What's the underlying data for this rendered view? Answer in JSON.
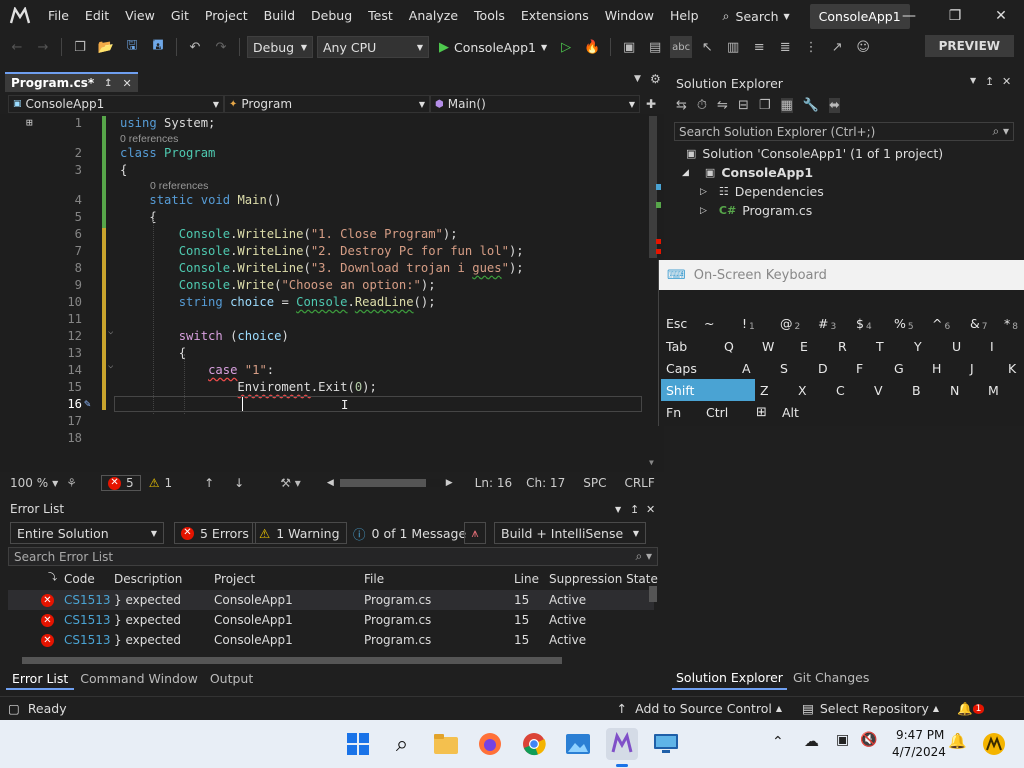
{
  "titlebar": {
    "menu": [
      "File",
      "Edit",
      "View",
      "Git",
      "Project",
      "Build",
      "Debug",
      "Test",
      "Analyze",
      "Tools",
      "Extensions",
      "Window",
      "Help"
    ],
    "search_label": "Search",
    "solution_name": "ConsoleApp1"
  },
  "toolbar": {
    "config": "Debug",
    "platform": "Any CPU",
    "start_target": "ConsoleApp1",
    "preview_label": "PREVIEW"
  },
  "editor": {
    "tab_label": "Program.cs*",
    "nav_project": "ConsoleApp1",
    "nav_class": "Program",
    "nav_member": "Main()",
    "refs_label": "0 references",
    "zoom": "100 %",
    "error_count": "5",
    "warning_count": "1",
    "line": "Ln: 16",
    "col": "Ch: 17",
    "spacing": "SPC",
    "eol": "CRLF"
  },
  "code_lines": [
    "using System;",
    "class Program",
    "{",
    "static void Main()",
    "{",
    "Console.WriteLine(\"1. Close Program\");",
    "Console.WriteLine(\"2. Destroy Pc for fun lol\");",
    "Console.WriteLine(\"3. Download trojan i gues\");",
    "Console.Write(\"Choose an option:\");",
    "string choice = Console.ReadLine();",
    "",
    "switch (choice)",
    "{",
    "case \"1\":",
    "Enviroment.Exit(0);",
    "",
    "",
    ""
  ],
  "error_list": {
    "title": "Error List",
    "scope": "Entire Solution",
    "errors_btn": "5 Errors",
    "warnings_btn": "1 Warning",
    "messages_btn": "0 of 1 Message",
    "source": "Build + IntelliSense",
    "search_placeholder": "Search Error List",
    "columns": [
      "Code",
      "Description",
      "Project",
      "File",
      "Line",
      "Suppression State"
    ],
    "rows": [
      {
        "code": "CS1513",
        "desc": "} expected",
        "project": "ConsoleApp1",
        "file": "Program.cs",
        "line": "15",
        "state": "Active"
      },
      {
        "code": "CS1513",
        "desc": "} expected",
        "project": "ConsoleApp1",
        "file": "Program.cs",
        "line": "15",
        "state": "Active"
      },
      {
        "code": "CS1513",
        "desc": "} expected",
        "project": "ConsoleApp1",
        "file": "Program.cs",
        "line": "15",
        "state": "Active"
      }
    ],
    "bottom_tabs": [
      "Error List",
      "Command Window",
      "Output"
    ]
  },
  "solution_explorer": {
    "title": "Solution Explorer",
    "search_placeholder": "Search Solution Explorer (Ctrl+;)",
    "solution_label": "Solution 'ConsoleApp1' (1 of 1 project)",
    "project": "ConsoleApp1",
    "dependencies": "Dependencies",
    "file": "Program.cs",
    "bottom_tabs": [
      "Solution Explorer",
      "Git Changes"
    ]
  },
  "osk": {
    "title": "On-Screen Keyboard",
    "row1": [
      [
        "Esc",
        ""
      ],
      [
        "~",
        ""
      ],
      [
        "!",
        "1"
      ],
      [
        "@",
        "2"
      ],
      [
        "#",
        "3"
      ],
      [
        "$",
        "4"
      ],
      [
        "%",
        "5"
      ],
      [
        "^",
        "6"
      ],
      [
        "&",
        "7"
      ],
      [
        "*",
        "8"
      ]
    ],
    "row2": [
      "Tab",
      "Q",
      "W",
      "E",
      "R",
      "T",
      "Y",
      "U",
      "I"
    ],
    "row3": [
      "Caps",
      "A",
      "S",
      "D",
      "F",
      "G",
      "H",
      "J",
      "K"
    ],
    "row4": [
      "Shift",
      "Z",
      "X",
      "C",
      "V",
      "B",
      "N",
      "M"
    ],
    "row5": [
      "Fn",
      "Ctrl",
      "",
      "Alt"
    ]
  },
  "statusbar": {
    "ready": "Ready",
    "source_control": "Add to Source Control",
    "repository": "Select Repository",
    "notif_count": "1"
  },
  "taskbar": {
    "time": "9:47 PM",
    "date": "4/7/2024"
  },
  "colors": {
    "accent": "#6f9ff0",
    "error": "#e51400",
    "warning": "#f0c800",
    "shift_key": "#4aa3d3"
  }
}
